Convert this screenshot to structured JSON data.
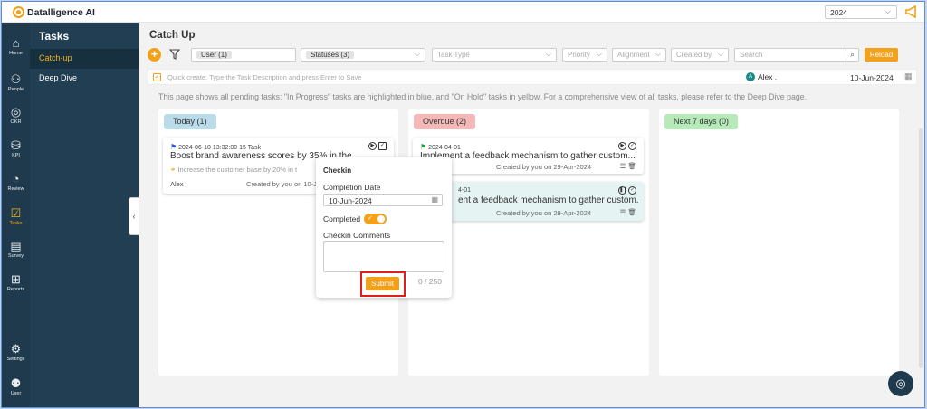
{
  "app": {
    "logo_text": "Datalligence AI",
    "year": "2024",
    "year_chevron": "⌵",
    "megaphone_icon": "megaphone-icon"
  },
  "rail": [
    {
      "label": "Home",
      "icon": "⌂"
    },
    {
      "label": "People",
      "icon": "⚇"
    },
    {
      "label": "OKR",
      "icon": "◎"
    },
    {
      "label": "KPI",
      "icon": "⛁"
    },
    {
      "label": "Review",
      "icon": "◔"
    },
    {
      "label": "Tasks",
      "icon": "☑"
    },
    {
      "label": "Survey",
      "icon": "▤"
    },
    {
      "label": "Reports",
      "icon": "⊞"
    },
    {
      "label": "Settings",
      "icon": "⚙"
    },
    {
      "label": "User",
      "icon": "⚉"
    }
  ],
  "panel": {
    "title": "Tasks",
    "items": [
      {
        "label": "Catch-up"
      },
      {
        "label": "Deep Dive"
      }
    ],
    "collapse": "‹"
  },
  "main": {
    "title": "Catch Up",
    "filters": {
      "add": "+",
      "user_chip": "User (1)",
      "status_chip": "Statuses (3)",
      "task_type_placeholder": "Task Type",
      "priority_placeholder": "Priority",
      "alignment_placeholder": "Alignment",
      "created_by_placeholder": "Created by",
      "search_placeholder": "Search",
      "search_icon": "⌕",
      "reload": "Reload",
      "chev": "⌵"
    },
    "quick_create": {
      "placeholder": "Quick create: Type the Task Description and press Enter to Save",
      "user": "Alex .",
      "avatar": "A",
      "date": "10-Jun-2024",
      "check": "✓",
      "cal": "▦"
    },
    "info": "This page shows all pending tasks: \"In Progress\" tasks are highlighted in blue, and \"On Hold\" tasks in yellow. For a comprehensive view of all tasks, please refer to the Deep Dive page."
  },
  "columns": [
    {
      "title": "Today (1)",
      "color": "#b9dce8",
      "cards": [
        {
          "meta": "2024-06-10  13:32:00  15  Task",
          "title": "Boost brand awareness scores by 35% in the next q",
          "sub": "Increase the customer base by 20% in t",
          "owner": "Alex .",
          "created": "Created by you on 10-Jun"
        }
      ]
    },
    {
      "title": "Overdue (2)",
      "color": "#f4b8b8",
      "cards": [
        {
          "meta": "2024-04-01",
          "title": "Implement a feedback mechanism to gather custom...",
          "created": "Created by you on 29-Apr-2024"
        },
        {
          "meta": "4-01",
          "title": "ent a feedback mechanism to gather custom...",
          "created": "Created by you on 29-Apr-2024"
        }
      ]
    },
    {
      "title": "Next 7 days (0)",
      "color": "#b6eab9",
      "cards": []
    }
  ],
  "checkin": {
    "title": "Checkin",
    "date_label": "Completion Date",
    "date_value": "10-Jun-2024",
    "completed_label": "Completed",
    "toggle_tick": "✓",
    "comments_label": "Checkin Comments",
    "submit": "Submit",
    "counter": "0 / 250"
  },
  "fab_icon": "◎"
}
